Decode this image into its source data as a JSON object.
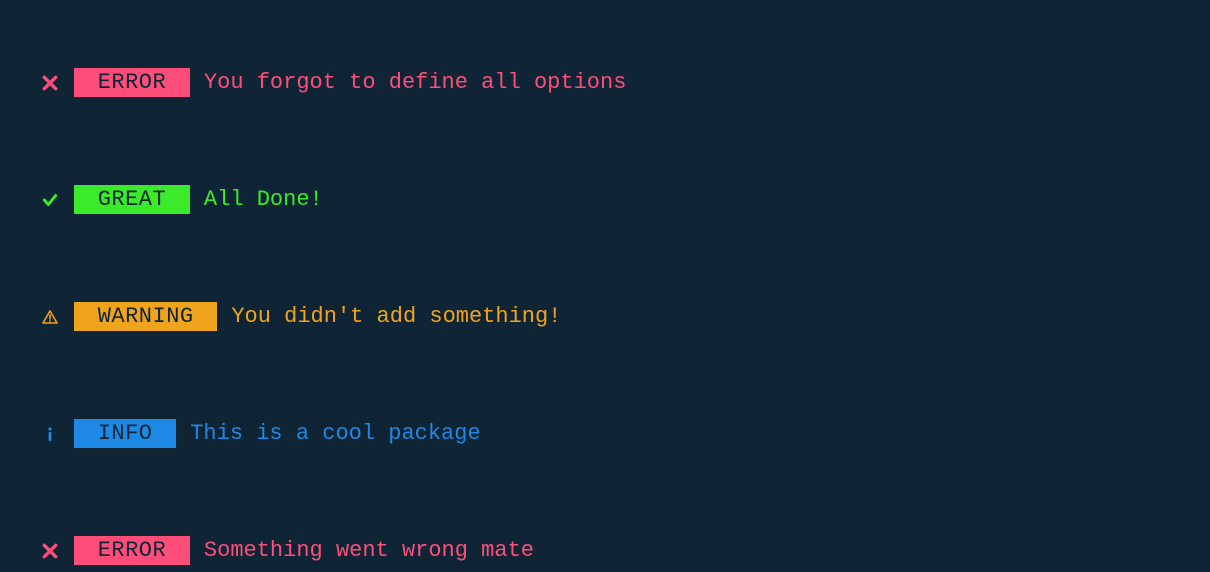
{
  "logs": [
    {
      "variant": "error",
      "icon": "cross-icon",
      "badge": " ERROR ",
      "message": "You forgot to define all options"
    },
    {
      "variant": "success",
      "icon": "check-icon",
      "badge": " GREAT ",
      "message": "All Done!"
    },
    {
      "variant": "warning",
      "icon": "warning-icon",
      "badge": " WARNING ",
      "message": "You didn't add something!"
    },
    {
      "variant": "info",
      "icon": "info-icon",
      "badge": " INFO ",
      "message": "This is a cool package"
    },
    {
      "variant": "error",
      "icon": "cross-icon",
      "badge": " ERROR ",
      "message": "Something went wrong mate"
    }
  ],
  "colors": {
    "error": "#ff4d7a",
    "success": "#3bea2a",
    "warning": "#f0a41d",
    "info": "#1e88e5",
    "background": "#0f2535"
  }
}
